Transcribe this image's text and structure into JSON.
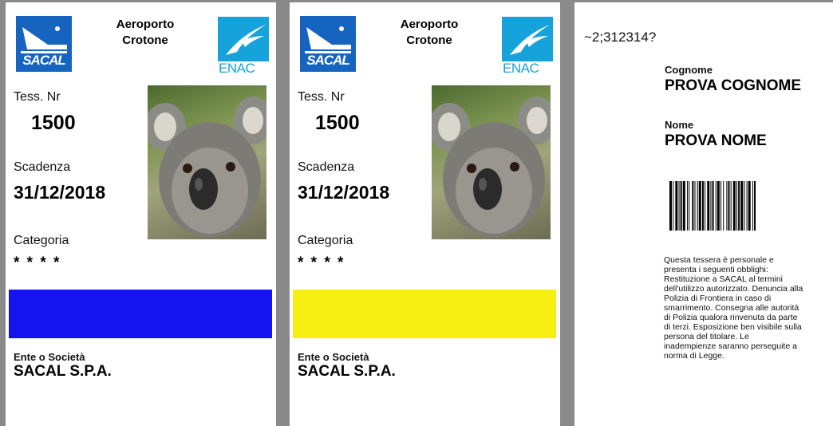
{
  "cards": [
    {
      "logo_left_text": "SACAL",
      "airport_line1": "Aeroporto",
      "airport_line2": "Crotone",
      "logo_right_text": "ENAC",
      "tess_label": "Tess. Nr",
      "tess_number": "1500",
      "expiry_label": "Scadenza",
      "expiry_date": "31/12/2018",
      "category_label": "Categoria",
      "category_value": "* * * *",
      "band_color": "#1414f0",
      "company_label": "Ente o Società",
      "company_value": "SACAL S.P.A."
    },
    {
      "logo_left_text": "SACAL",
      "airport_line1": "Aeroporto",
      "airport_line2": "Crotone",
      "logo_right_text": "ENAC",
      "tess_label": "Tess. Nr",
      "tess_number": "1500",
      "expiry_label": "Scadenza",
      "expiry_date": "31/12/2018",
      "category_label": "Categoria",
      "category_value": "* * * *",
      "band_color": "#f6f012",
      "company_label": "Ente o Società",
      "company_value": "SACAL S.P.A."
    }
  ],
  "back": {
    "code": "~2;312314?",
    "surname_label": "Cognome",
    "surname_value": "PROVA COGNOME",
    "name_label": "Nome",
    "name_value": "PROVA NOME",
    "notice_lines": [
      "Questa tessera è personale e",
      "presenta i seguenti obblighi:",
      "Restituzione a SACAL al termini",
      "dell'utilizzo autorizzato. Denuncia alla",
      "Polizia di Frontiera in caso di",
      "smarrimento. Consegna alle autorità",
      "di Polizia qualora rinvenuta da parte",
      "di terzi. Esposizione ben visibile sulla",
      "persona del titolare. Le",
      "inadempienze saranno perseguite a",
      "norma di Legge."
    ]
  },
  "colors": {
    "sacal_blue": "#1565c0",
    "enac_cyan": "#16a3dc",
    "frame_gray": "#8a8a8a"
  },
  "icons": [
    "sacal-logo-icon",
    "enac-logo-icon",
    "koala-photo",
    "barcode-icon"
  ]
}
